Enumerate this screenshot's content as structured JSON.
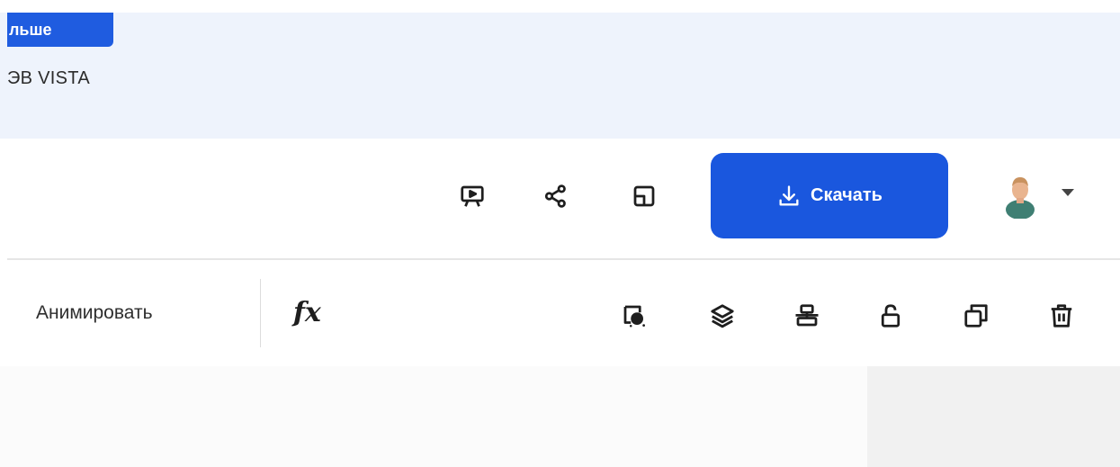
{
  "banner": {
    "button_label": "льше",
    "promo_text": "ЭВ VISTA",
    "background_color": "#eef3fc",
    "button_color": "#1f5ce0"
  },
  "header": {
    "icons": [
      "presentation-icon",
      "share-icon",
      "resize-icon"
    ],
    "download_label": "Скачать",
    "download_icon": "download-icon",
    "accent_color": "#1a57de",
    "avatar_icon": "user-avatar",
    "menu_icon": "chevron-down-icon"
  },
  "edit_toolbar": {
    "animate_label": "Анимировать",
    "effects_label": "fx",
    "icons": [
      "background-remove-icon",
      "layers-icon",
      "align-icon",
      "lock-icon",
      "duplicate-icon",
      "trash-icon"
    ]
  }
}
